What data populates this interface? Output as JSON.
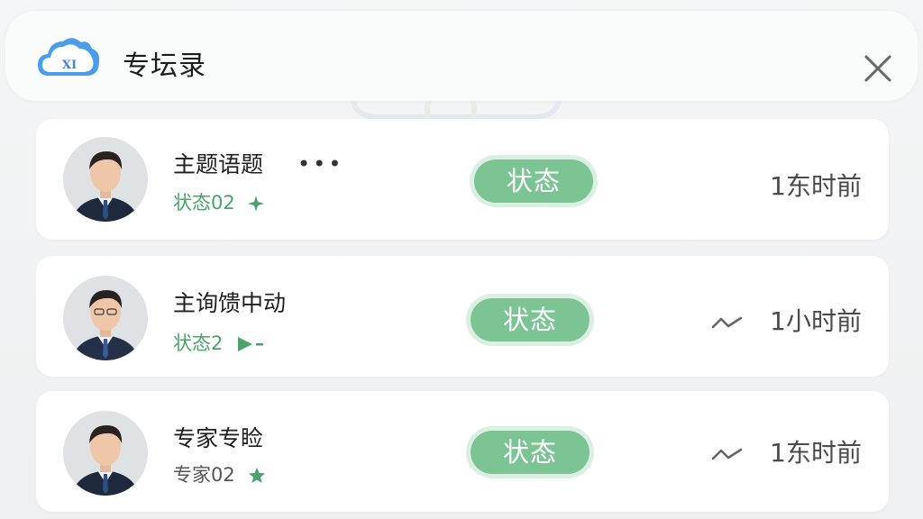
{
  "header": {
    "title": "专坛录",
    "logo_text": "XI"
  },
  "colors": {
    "accent_green": "#7cc494",
    "sub_green": "#4aa36a",
    "sub_gray": "#555555",
    "logo_blue": "#4a9ee8"
  },
  "records": [
    {
      "name": "主题语题",
      "sub_label": "状态02",
      "sub_icon": "sparkle-icon",
      "status": "状态",
      "time": "1东时前",
      "has_more": true,
      "has_trend": false
    },
    {
      "name": "主询馈中动",
      "sub_label": "状态2",
      "sub_icon": "send-icon",
      "status": "状态",
      "time": "1小时前",
      "has_more": false,
      "has_trend": true
    },
    {
      "name": "专家专睑",
      "sub_label": "专家02",
      "sub_icon": "star-icon",
      "status": "状态",
      "time": "1东时前",
      "has_more": false,
      "has_trend": true
    }
  ]
}
